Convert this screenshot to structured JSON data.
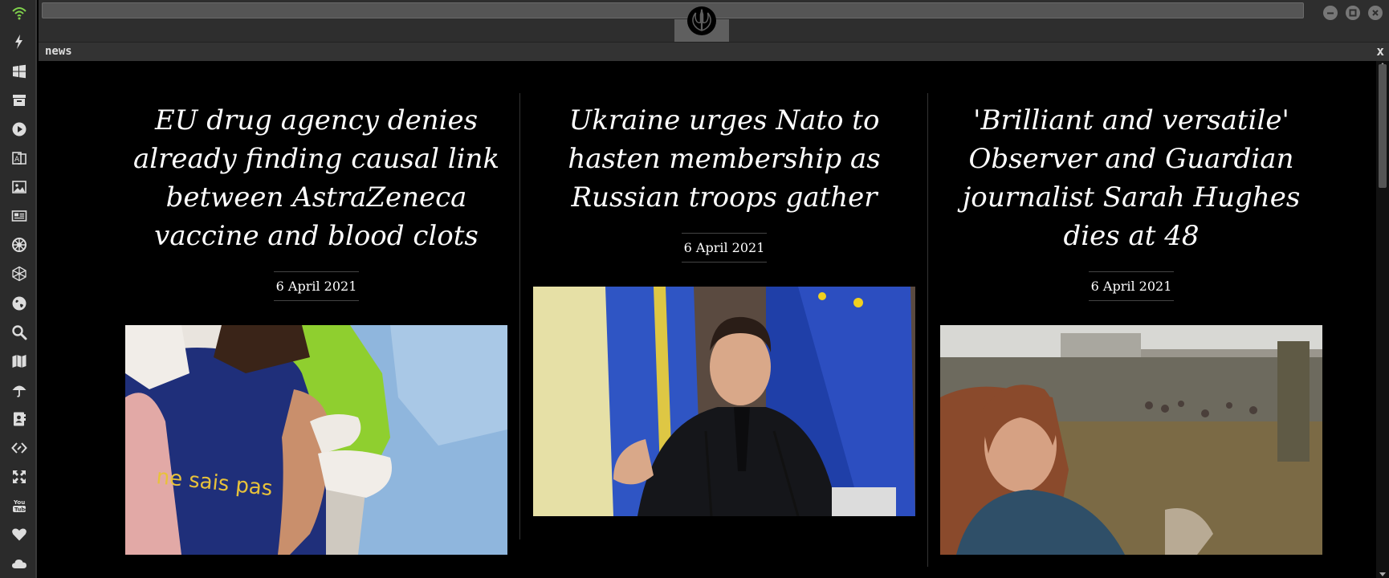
{
  "panel": {
    "title": "news",
    "close": "x"
  },
  "dock": {
    "items": [
      {
        "name": "wifi-icon"
      },
      {
        "name": "lightning-icon"
      },
      {
        "name": "windows-icon"
      },
      {
        "name": "archive-icon"
      },
      {
        "name": "play-icon"
      },
      {
        "name": "translate-icon"
      },
      {
        "name": "image-icon"
      },
      {
        "name": "newspaper-icon"
      },
      {
        "name": "galactic-empire-icon"
      },
      {
        "name": "polyhedron-icon"
      },
      {
        "name": "globe-icon"
      },
      {
        "name": "search-icon"
      },
      {
        "name": "map-icon"
      },
      {
        "name": "umbrella-icon"
      },
      {
        "name": "contacts-icon"
      },
      {
        "name": "code-icon"
      },
      {
        "name": "expand-icon"
      },
      {
        "name": "youtube-icon"
      },
      {
        "name": "heart-icon"
      },
      {
        "name": "cloud-icon"
      }
    ]
  },
  "articles": [
    {
      "headline": "EU drug agency denies already finding causal link between AstraZeneca vaccine and blood clots",
      "date": "6 April 2021",
      "image_text": "ne sais pas"
    },
    {
      "headline": "Ukraine urges Nato to hasten membership as Russian troops gather",
      "date": "6 April 2021"
    },
    {
      "headline": "'Brilliant and versatile' Observer and Guardian journalist Sarah Hughes dies at 48",
      "date": "6 April 2021"
    }
  ],
  "colors": {
    "wifi": "#7fd14c",
    "dock_bg": "#2b2b2b",
    "page_bg": "#000000"
  }
}
